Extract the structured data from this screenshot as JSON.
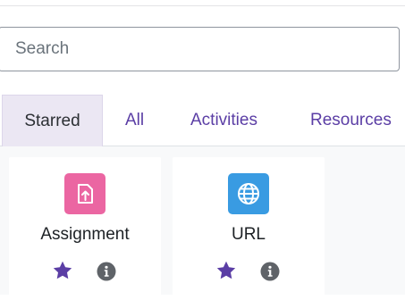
{
  "search": {
    "placeholder": "Search",
    "value": ""
  },
  "tabs": [
    {
      "label": "Starred",
      "active": true
    },
    {
      "label": "All",
      "active": false
    },
    {
      "label": "Activities",
      "active": false
    },
    {
      "label": "Resources",
      "active": false
    }
  ],
  "modules": [
    {
      "label": "Assignment",
      "icon": "assignment-icon",
      "color": "#eb66a2"
    },
    {
      "label": "URL",
      "icon": "globe-icon",
      "color": "#399be2"
    }
  ],
  "colors": {
    "accent": "#5b3ea5",
    "star": "#5b3ea5",
    "info": "#5f6368"
  }
}
